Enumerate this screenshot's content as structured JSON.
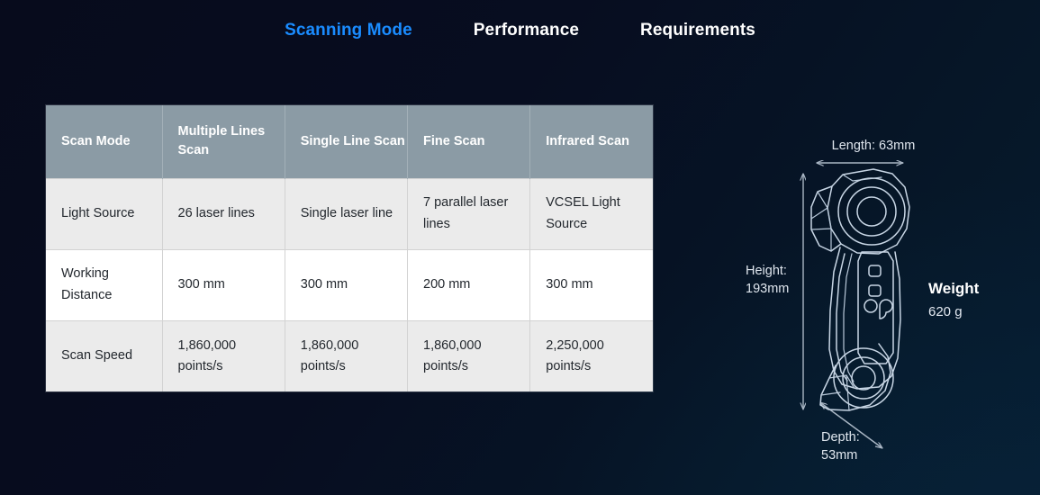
{
  "theme": {
    "background_dark": "#070b1c",
    "background_light": "#061b2e",
    "accent_blue": "#1a8cff",
    "table_header_bg": "#8b9ba5",
    "row_alt_bg": "#ebebeb",
    "row_bg": "#ffffff",
    "wire_stroke": "#c8d6e5"
  },
  "tabs": [
    {
      "label": "Scanning Mode",
      "active": true
    },
    {
      "label": "Performance",
      "active": false
    },
    {
      "label": "Requirements",
      "active": false
    }
  ],
  "table": {
    "headers": [
      "Scan Mode",
      "Multiple Lines Scan",
      "Single Line Scan",
      "Fine Scan",
      "Infrared Scan"
    ],
    "rows": [
      {
        "label": "Light Source",
        "cells": [
          "26 laser lines",
          "Single laser line",
          "7 parallel laser lines",
          "VCSEL Light Source"
        ]
      },
      {
        "label": "Working Distance",
        "cells": [
          "300 mm",
          "300 mm",
          "200 mm",
          "300 mm"
        ]
      },
      {
        "label": "Scan Speed",
        "cells": [
          "1,860,000 points/s",
          "1,860,000 points/s",
          "1,860,000 points/s",
          "2,250,000 points/s"
        ]
      }
    ]
  },
  "diagram": {
    "length_label": "Length: 63mm",
    "height_label_line1": "Height:",
    "height_label_line2": "193mm",
    "depth_label_line1": "Depth:",
    "depth_label_line2": "53mm",
    "weight_title": "Weight",
    "weight_value": "620 g"
  }
}
